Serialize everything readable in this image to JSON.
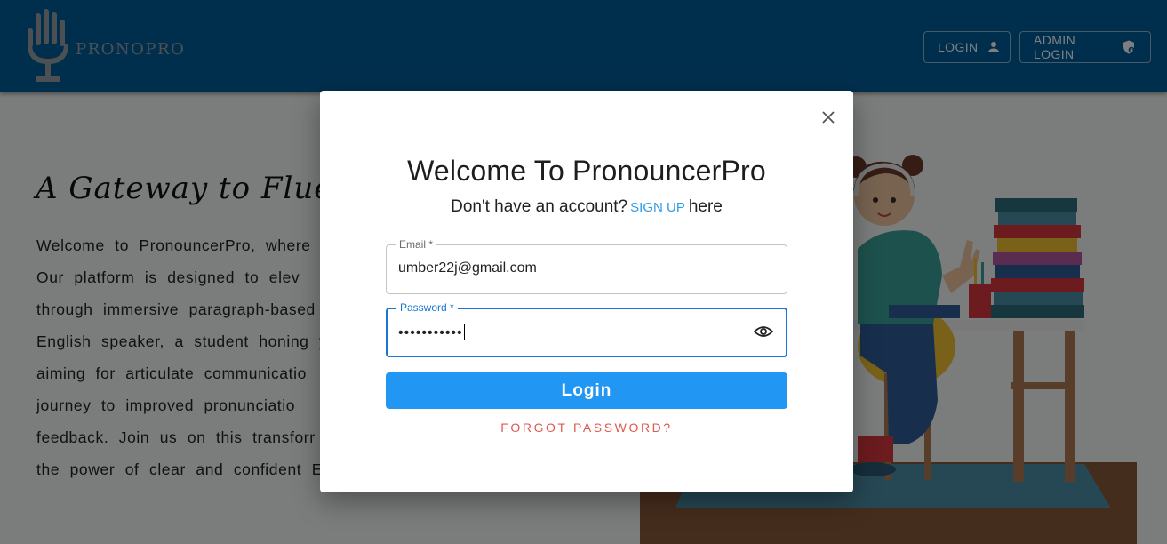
{
  "header": {
    "brand": "PRONOPRO",
    "logo_icon": "microphone-hand-icon",
    "login_label": "LOGIN",
    "login_icon": "person-icon",
    "admin_login_label": "ADMIN LOGIN",
    "admin_icon": "shield-lock-icon",
    "bg_color": "#005f9b"
  },
  "hero": {
    "title": "A Gateway to Flue",
    "lines": [
      "Welcome to PronouncerPro, where",
      "Our platform is designed to elev",
      "through immersive paragraph-based",
      "English speaker, a student honing y",
      "aiming for articulate communicatio",
      "journey to improved pronunciatio",
      "feedback. Join us on this transforr",
      "the power of clear and confident En"
    ]
  },
  "modal": {
    "close_icon": "close-icon",
    "title": "Welcome To PronouncerPro",
    "subtitle_prefix": "Don't have an account?",
    "signup_link": "SIGN UP",
    "subtitle_suffix": "here",
    "email_label": "Email *",
    "email_value": "umber22j@gmail.com",
    "password_label": "Password *",
    "password_value": "•••••••••••",
    "password_toggle_icon": "eye-icon",
    "login_button": "Login",
    "forgot_password": "FORGOT PASSWORD?",
    "accent_color": "#2196f3",
    "error_color": "#e0584f"
  }
}
